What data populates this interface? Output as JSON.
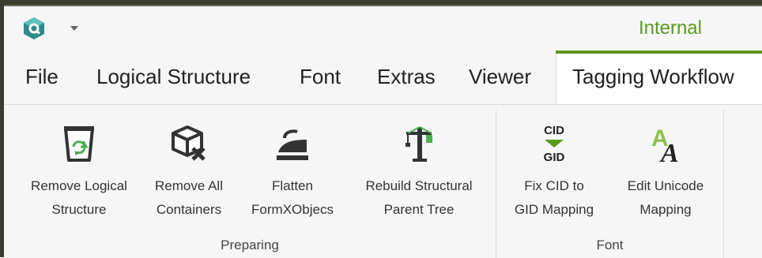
{
  "title_bar": {
    "logo_icon": "app-logo-icon",
    "quick_access_icon": "chevron-down-icon",
    "context_label": "Internal",
    "accent_color": "#5a9a1d"
  },
  "tabs": [
    {
      "label": "File"
    },
    {
      "label": "Logical Structure"
    },
    {
      "label": "Font"
    },
    {
      "label": "Extras"
    },
    {
      "label": "Viewer"
    },
    {
      "label": "Tagging Workflow",
      "active": true
    }
  ],
  "ribbon": {
    "groups": [
      {
        "label": "Preparing",
        "commands": [
          {
            "line1": "Remove Logical",
            "line2": "Structure",
            "icon": "recycle-bin-icon"
          },
          {
            "line1": "Remove All",
            "line2": "Containers",
            "icon": "remove-box-icon"
          },
          {
            "line1": "Flatten",
            "line2": "FormXObjecs",
            "icon": "iron-icon"
          },
          {
            "line1": "Rebuild Structural",
            "line2": "Parent Tree",
            "icon": "crane-icon"
          }
        ]
      },
      {
        "label": "Font",
        "commands": [
          {
            "line1": "Fix CID to",
            "line2": "GID Mapping",
            "icon": "cid-gid-icon",
            "icon_text_top": "CID",
            "icon_text_bottom": "GID"
          },
          {
            "line1": "Edit Unicode",
            "line2": "Mapping",
            "icon": "font-a-icon",
            "icon_text_a1": "A",
            "icon_text_a2": "A"
          }
        ]
      }
    ]
  }
}
